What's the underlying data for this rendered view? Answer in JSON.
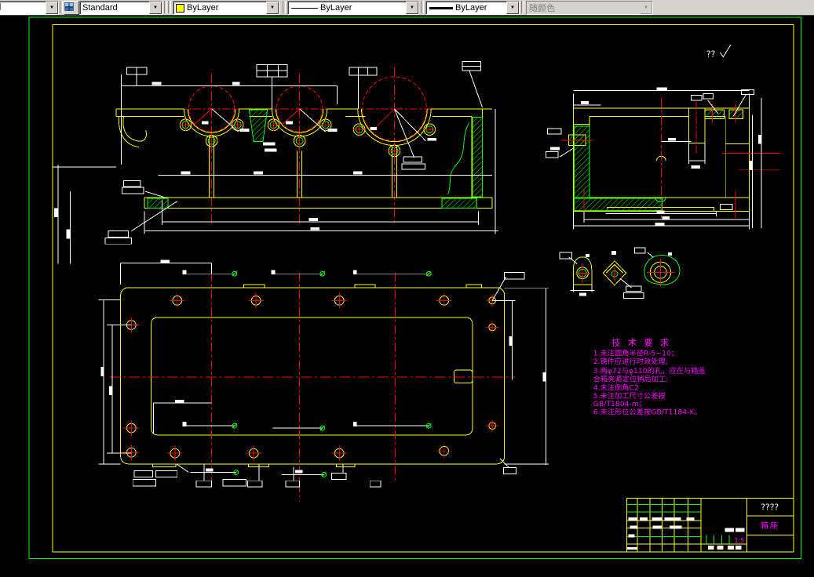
{
  "toolbar": {
    "text_style": {
      "value": "Standard"
    },
    "color": {
      "value": "ByLayer",
      "swatch": "#ffff00"
    },
    "linetype": {
      "value": "ByLayer"
    },
    "lineweight": {
      "value": "ByLayer"
    },
    "plot_style": {
      "value": "随颜色"
    },
    "arrow": "▼"
  },
  "drawing": {
    "surface_note": "??",
    "tech_requirements": {
      "title": "技 术 要 求",
      "lines": [
        "1.未注圆角半径R-5~10；",
        "2.铸件应进行时效处理;",
        "3.两φ72与φ110的孔，应在与箱盖",
        "合箱夹紧定位销后加工;",
        "4.未注倒角C2",
        "5.未注加工尺寸公差按",
        "GB/T1804-m；",
        "6.未注形位公差按GB/T1184-K。"
      ]
    },
    "title_block": {
      "placeholder_text": "????",
      "part_name": "箱座",
      "scale": "1:5"
    },
    "colors": {
      "outline": "#ffff00",
      "centerline": "#ff0000",
      "hatch": "#00ff00",
      "dimension": "#ffffff",
      "annotation": "#ff00ff",
      "frame": "#00ff00"
    }
  }
}
